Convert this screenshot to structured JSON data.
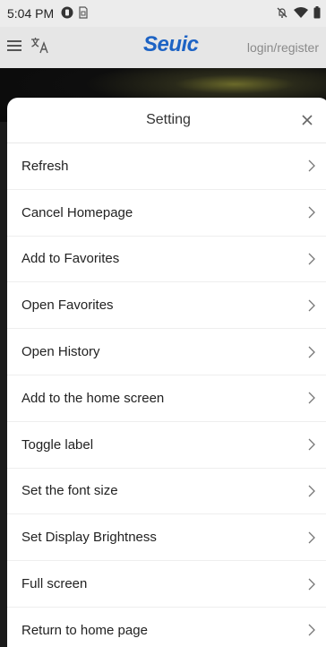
{
  "status_bar": {
    "time": "5:04 PM",
    "icons": [
      "vpn-key-icon",
      "sim-icon",
      "mute-icon",
      "wifi-icon",
      "battery-icon"
    ]
  },
  "header": {
    "menu_icon": "hamburger-icon",
    "translate_icon": "translate-icon",
    "brand": "Seuic",
    "login_link": "login/register"
  },
  "sheet": {
    "title": "Setting",
    "close_icon": "close-icon",
    "items": [
      {
        "label": "Refresh"
      },
      {
        "label": "Cancel Homepage"
      },
      {
        "label": "Add to Favorites"
      },
      {
        "label": "Open Favorites"
      },
      {
        "label": "Open History"
      },
      {
        "label": "Add to the home screen"
      },
      {
        "label": "Toggle label"
      },
      {
        "label": "Set the font size"
      },
      {
        "label": "Set Display Brightness"
      },
      {
        "label": "Full screen"
      },
      {
        "label": "Return to home page"
      }
    ]
  },
  "colors": {
    "brand": "#1d63c4",
    "sheet_background": "#ffffff",
    "header_background": "#e6e6e6"
  }
}
